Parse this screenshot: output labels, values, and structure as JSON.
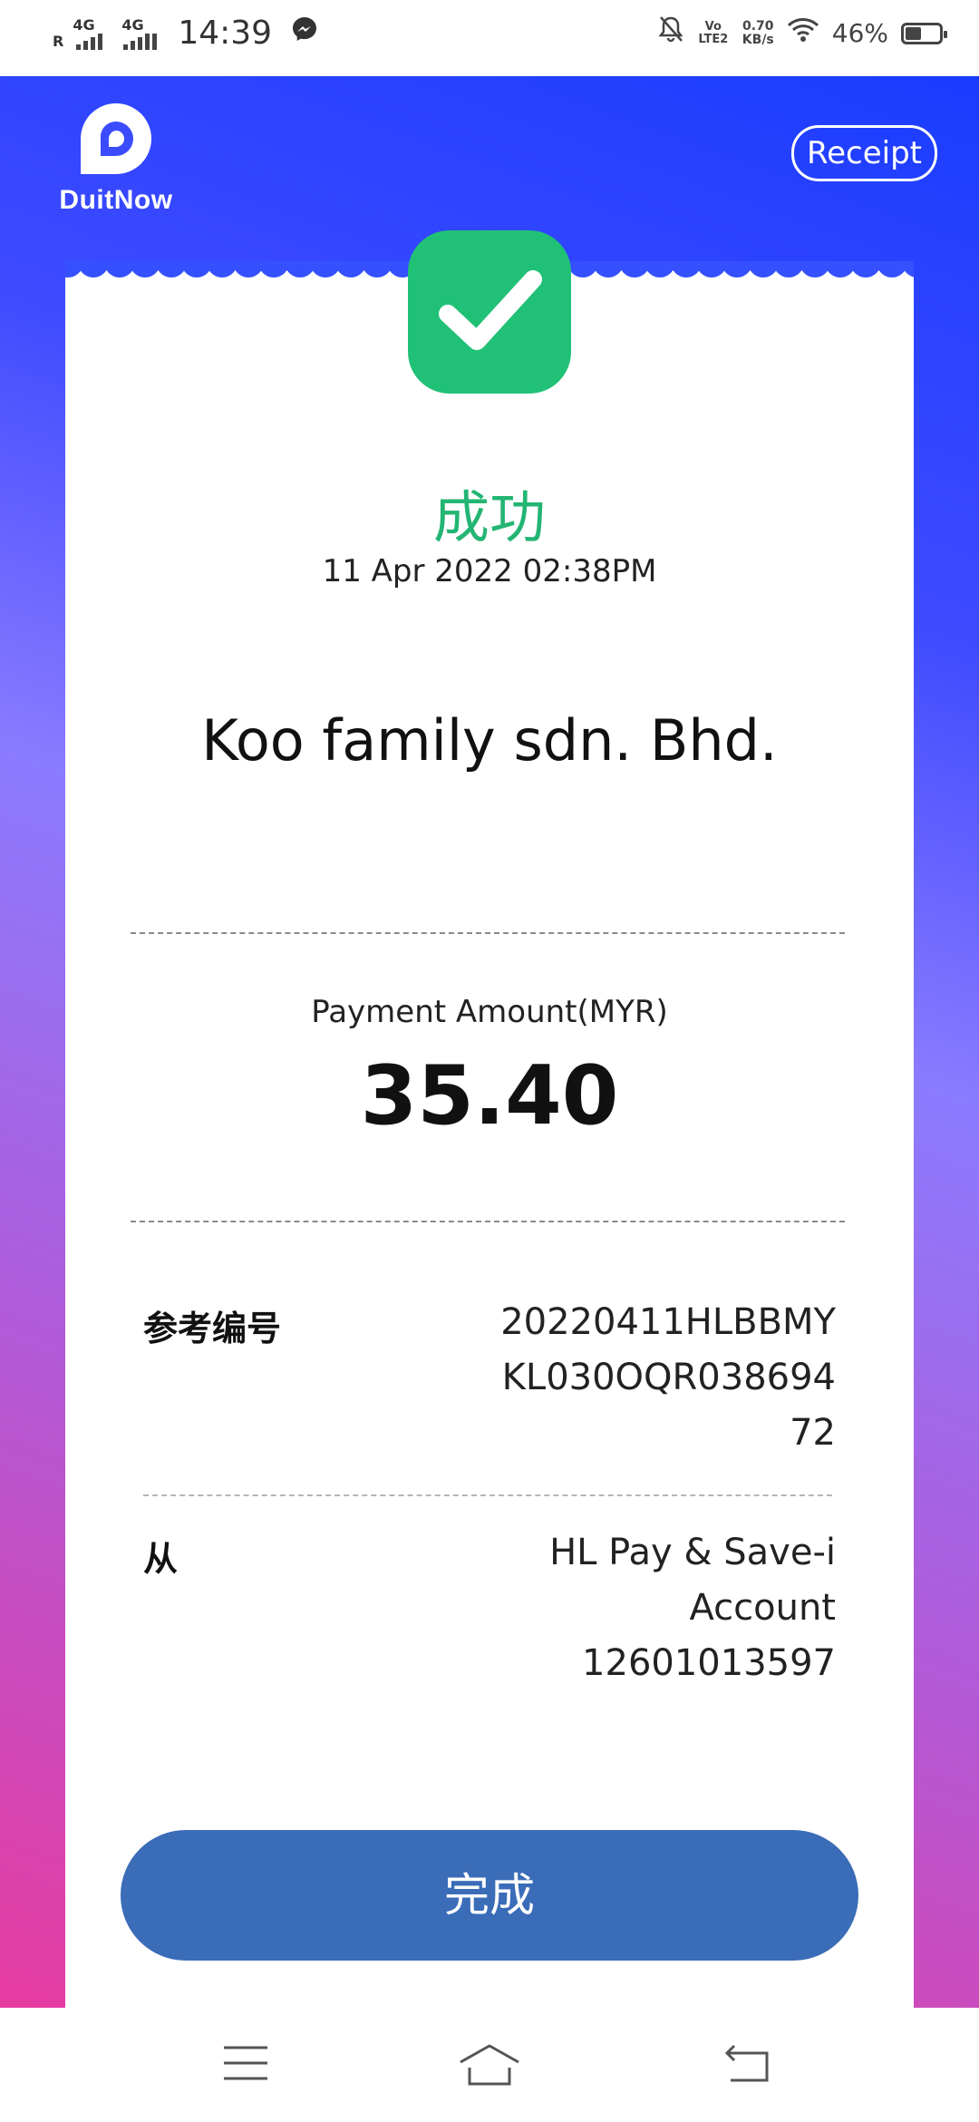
{
  "status_bar": {
    "carrier_left": "R",
    "network1": "4G",
    "network2": "4G",
    "time": "14:39",
    "volte": "Vo LTE2",
    "speed": "0.70",
    "speed_unit": "KB/s",
    "battery": "46%",
    "battery_level": 0.46
  },
  "header": {
    "logo_text": "DuitNow",
    "receipt_label": "Receipt"
  },
  "receipt": {
    "status": "成功",
    "datetime": "11 Apr 2022 02:38PM",
    "merchant": "Koo family sdn. Bhd.",
    "amount_label": "Payment Amount(MYR)",
    "amount": "35.40",
    "reference_label": "参考编号",
    "reference_value": "20220411HLBBMY\nKL030OQR038694\n72",
    "from_label": "从",
    "from_value": "HL Pay & Save-i\nAccount \n12601013597"
  },
  "actions": {
    "done_label": "完成"
  },
  "colors": {
    "success_green": "#23b573",
    "button_blue": "#3b6cb8",
    "gradient_top": "#1a3cff",
    "gradient_bottom": "#e63ba0"
  },
  "nav": {
    "icons": [
      "menu-icon",
      "home-icon",
      "back-icon"
    ]
  }
}
